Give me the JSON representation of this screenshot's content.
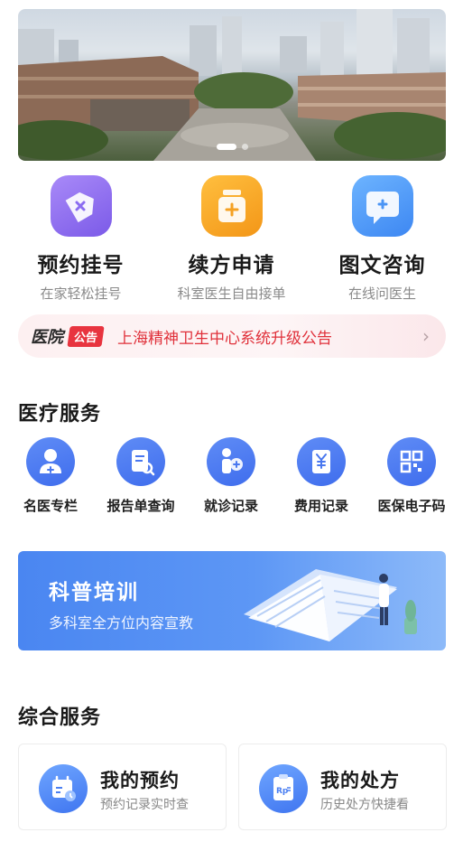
{
  "banner": {
    "image": "hospital-campus-photo",
    "slides": 2,
    "active_slide": 1
  },
  "features": [
    {
      "title": "预约挂号",
      "subtitle": "在家轻松挂号",
      "icon": "tag-icon",
      "color": "#8f6ff3"
    },
    {
      "title": "续方申请",
      "subtitle": "科室医生自由接单",
      "icon": "medicine-bottle-icon",
      "color": "#f7a22b"
    },
    {
      "title": "图文咨询",
      "subtitle": "在线问医生",
      "icon": "chat-bubble-icon",
      "color": "#4d9cf7"
    }
  ],
  "notice": {
    "label": "医院",
    "badge": "公告",
    "text": "上海精神卫生中心系统升级公告",
    "chevron": "›"
  },
  "medical_services": {
    "title": "医疗服务",
    "items": [
      {
        "label": "名医专栏",
        "icon": "doctor-icon"
      },
      {
        "label": "报告单查询",
        "icon": "report-search-icon"
      },
      {
        "label": "就诊记录",
        "icon": "visit-record-icon"
      },
      {
        "label": "费用记录",
        "icon": "yuan-receipt-icon"
      },
      {
        "label": "医保电子码",
        "icon": "qr-code-icon"
      }
    ]
  },
  "science": {
    "title": "科普培训",
    "subtitle": "多科室全方位内容宣教"
  },
  "general_services": {
    "title": "综合服务",
    "cards": [
      {
        "title": "我的预约",
        "subtitle": "预约记录实时查",
        "icon": "calendar-icon"
      },
      {
        "title": "我的处方",
        "subtitle": "历史处方快捷看",
        "icon": "prescription-icon"
      }
    ]
  }
}
